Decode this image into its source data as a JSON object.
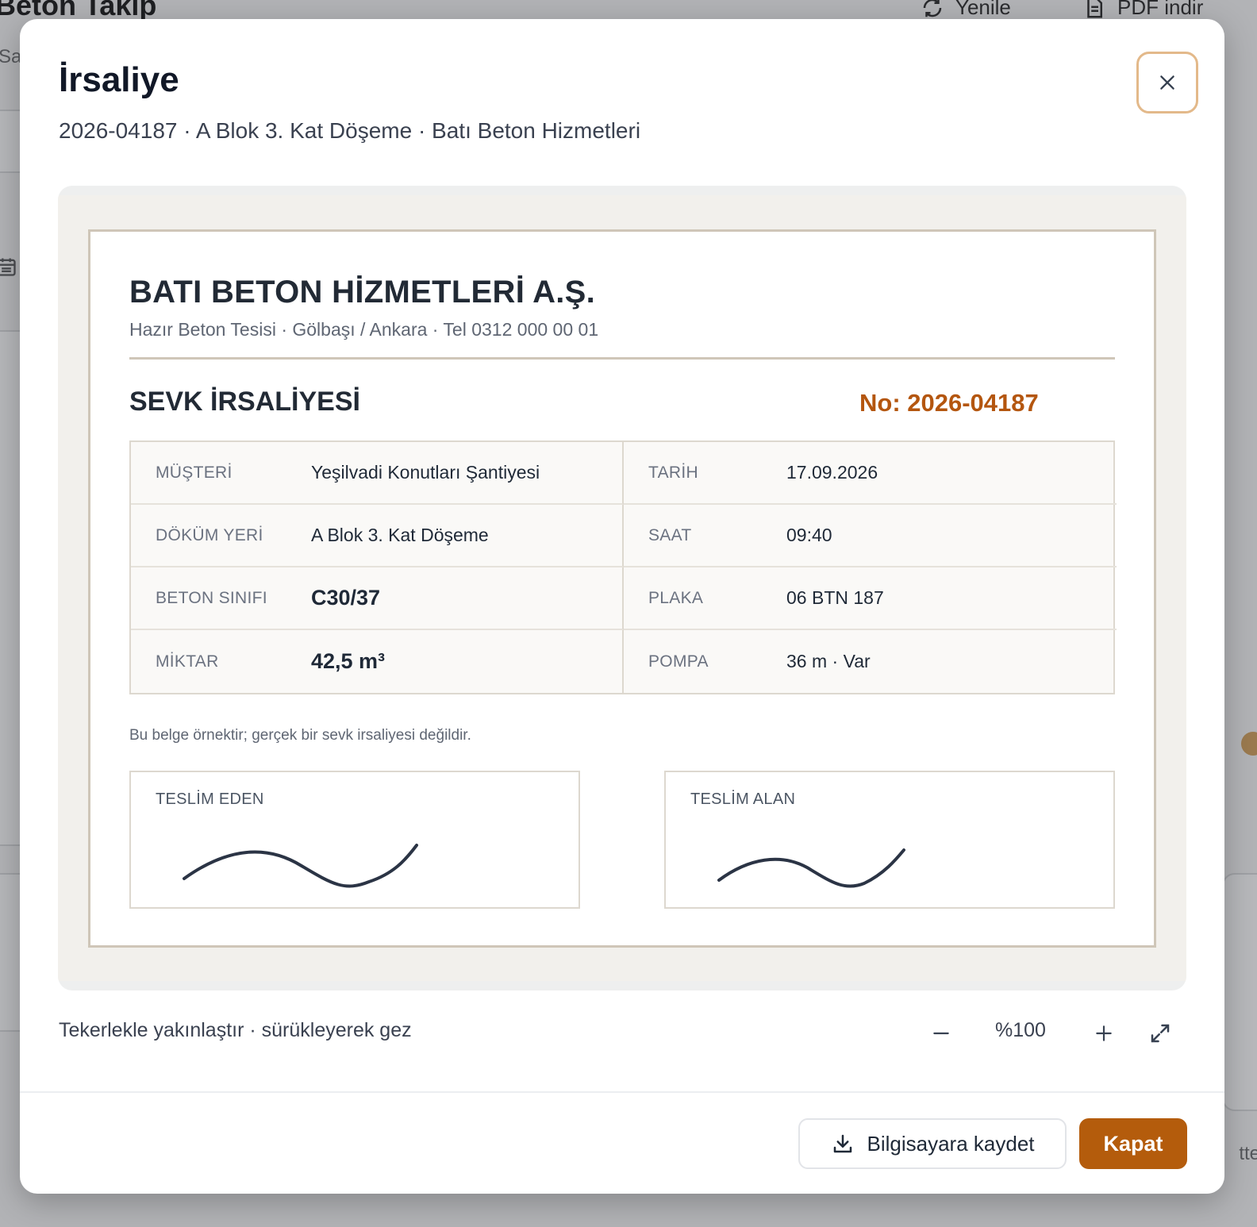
{
  "background": {
    "app_title": "Beton Takip",
    "refresh_label": "Yenile",
    "pdf_label": "PDF indir",
    "partial_left_text": "Sa",
    "partial_right_text": "tte"
  },
  "modal": {
    "title": "İrsaliye",
    "subtitle": "2026-04187 · A Blok 3. Kat Döşeme · Batı Beton Hizmetleri",
    "close_icon": "close-icon"
  },
  "document": {
    "company_name": "BATI BETON HİZMETLERİ A.Ş.",
    "company_info": "Hazır Beton Tesisi · Gölbaşı / Ankara · Tel 0312 000 00 01",
    "doc_type": "SEVK İRSALİYESİ",
    "doc_no": "No: 2026-04187",
    "accent_color": "#b4560f",
    "rows": [
      {
        "left_label": "MÜŞTERİ",
        "left_value": "Yeşilvadi Konutları Şantiyesi",
        "right_label": "TARİH",
        "right_value": "17.09.2026"
      },
      {
        "left_label": "DÖKÜM YERİ",
        "left_value": "A Blok 3. Kat Döşeme",
        "right_label": "SAAT",
        "right_value": "09:40"
      },
      {
        "left_label": "BETON SINIFI",
        "left_value": "C30/37",
        "right_label": "PLAKA",
        "right_value": "06 BTN 187"
      },
      {
        "left_label": "MİKTAR",
        "left_value": "42,5 m³",
        "right_label": "POMPA",
        "right_value": "36 m · Var"
      }
    ],
    "note": "Bu belge örnektir; gerçek bir sevk irsaliyesi değildir.",
    "signature_left_label": "TESLİM EDEN",
    "signature_right_label": "TESLİM ALAN"
  },
  "zoom": {
    "hint": "Tekerlekle yakınlaştır · sürükleyerek gez",
    "value": "%100",
    "zoom_out_icon": "minus-icon",
    "zoom_in_icon": "plus-icon",
    "fullscreen_icon": "expand-icon"
  },
  "footer": {
    "save_label": "Bilgisayara kaydet",
    "save_icon": "download-icon",
    "close_label": "Kapat",
    "primary_color": "#b45c0c"
  }
}
